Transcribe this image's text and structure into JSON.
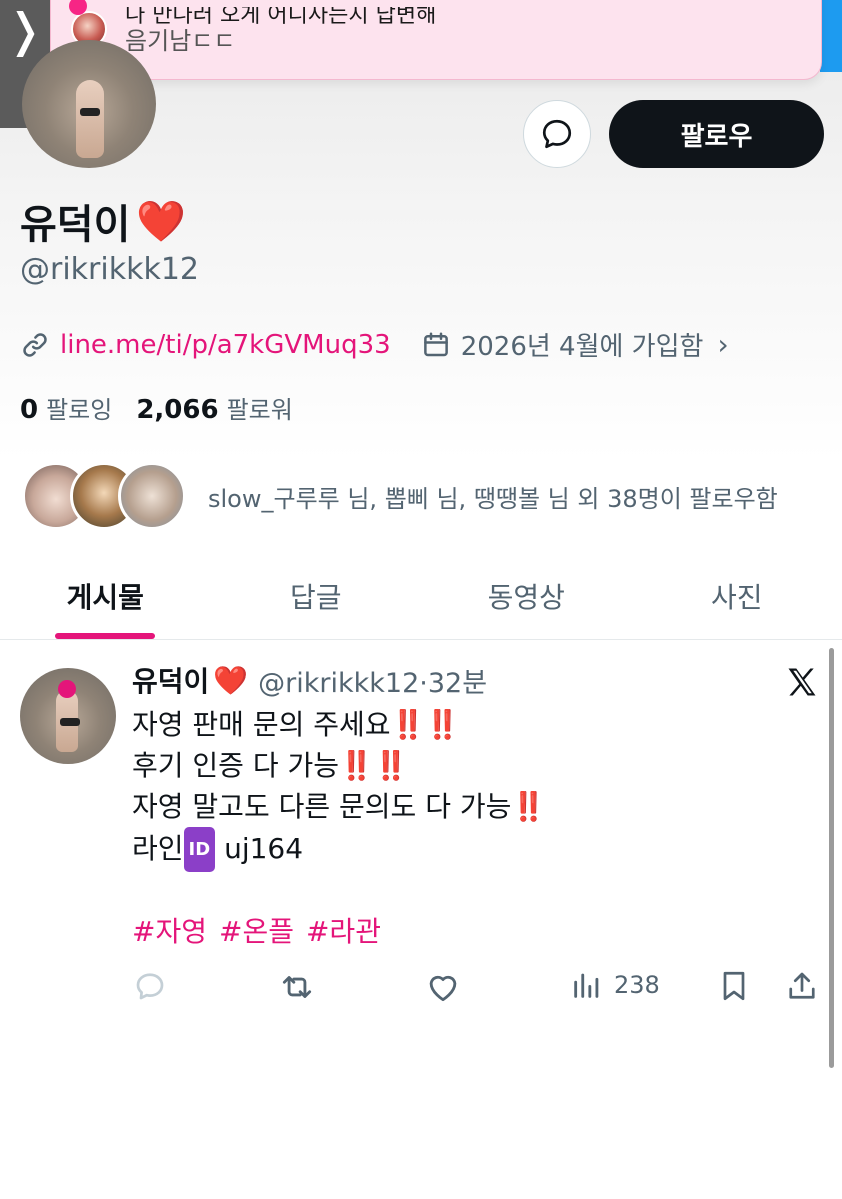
{
  "notification": {
    "title": "나 만나러 오게 어디사는지 답변해",
    "subtitle": "음기남ㄷㄷ"
  },
  "back_label": "❭",
  "profile": {
    "display_name": "유덕이",
    "name_emoji": "❤️",
    "handle": "@rikrikkk12",
    "link": "line.me/ti/p/a7kGVMuq33",
    "joined": "2026년 4월에 가입함",
    "following_count": "0",
    "following_label": "팔로잉",
    "followers_count": "2,066",
    "followers_label": "팔로워",
    "known_followers": "slow_구루루 님, 뽑삐 님, 땡땡볼 님 외 38명이 팔로우함",
    "follow_button": "팔로우"
  },
  "tabs": [
    {
      "label": "게시물",
      "active": true
    },
    {
      "label": "답글",
      "active": false
    },
    {
      "label": "동영상",
      "active": false
    },
    {
      "label": "사진",
      "active": false
    }
  ],
  "post": {
    "author": "유덕이",
    "author_emoji": "❤️",
    "handle_time": "@rikrikkk12·32분",
    "lines": [
      {
        "text": "자영 판매 문의 주세요",
        "bangs": "‼️‼️"
      },
      {
        "text": "후기 인증 다 가능",
        "bangs": "‼️‼️"
      },
      {
        "text": "자영 말고도 다른 문의도 다 가능",
        "bangs": "‼️"
      }
    ],
    "line_id_prefix": "라인",
    "id_badge": "ID",
    "line_id": "uj164",
    "hashtags": [
      "#자영",
      "#온플",
      "#라관"
    ],
    "views": "238"
  },
  "colors": {
    "accent": "#e4157a",
    "text": "#0f1419",
    "muted": "#536471",
    "banner_bg": "#fde3ee"
  }
}
